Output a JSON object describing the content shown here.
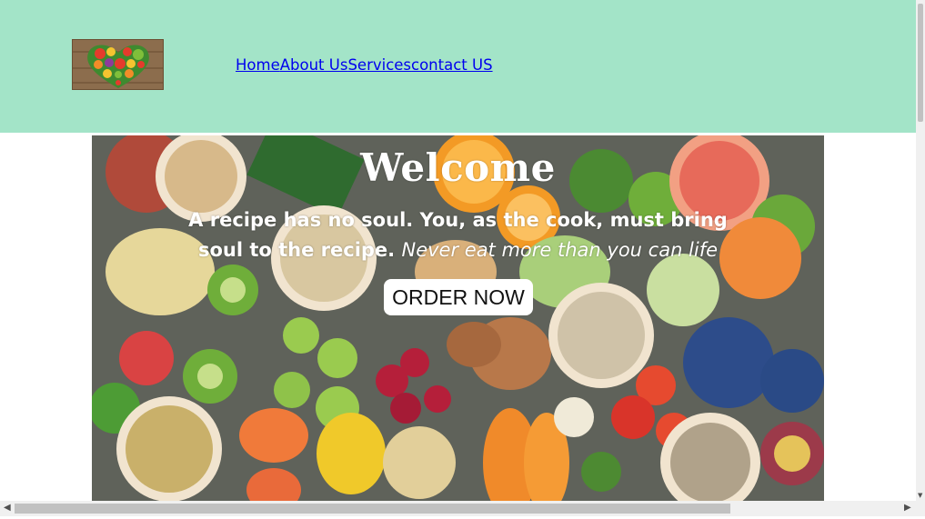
{
  "header": {
    "background": "#a3e4c8",
    "logo_icon": "heart-vegetables-logo",
    "nav": [
      {
        "label": "Home"
      },
      {
        "label": "About Us"
      },
      {
        "label": "Services"
      },
      {
        "label": "contact US"
      }
    ]
  },
  "hero": {
    "background_icon": "fruits-vegetables-photo",
    "title": "Welcome",
    "subtitle": "A recipe has no soul. You, as the cook, must bring soul to the recipe.",
    "quote": "Never eat more than you can life",
    "order_label": "ORDER NOW"
  },
  "scrollbars": {
    "left_arrow": "◀",
    "right_arrow": "▶",
    "down_arrow": "▼"
  }
}
